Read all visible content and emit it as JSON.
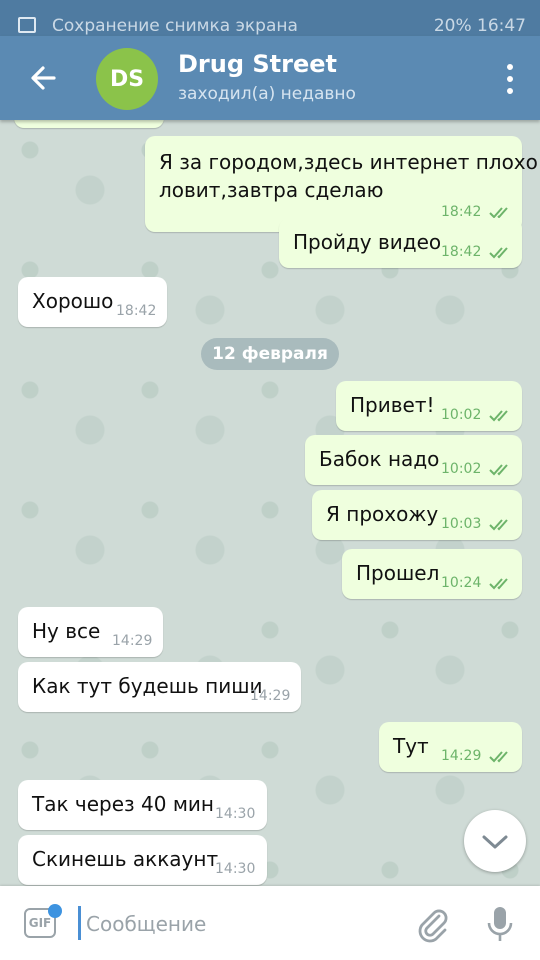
{
  "status_bar": {
    "notification_text": "Сохранение снимка экрана",
    "right_text": "20%  16:47"
  },
  "header": {
    "avatar_initials": "DS",
    "avatar_color": "#8bc34a",
    "title": "Drug Street",
    "status": "заходил(а) недавно"
  },
  "messages": [
    {
      "dir": "out",
      "text": "Я за городом,здесь интернет плохо",
      "text2": "ловит,завтра сделаю",
      "time": "18:42",
      "read": true
    },
    {
      "dir": "out",
      "text": "Пройду видео",
      "time": "18:42",
      "read": true
    },
    {
      "dir": "in",
      "text": "Хорошо",
      "time": "18:42"
    },
    {
      "dir": "out",
      "text": "Привет!",
      "time": "10:02",
      "read": true
    },
    {
      "dir": "out",
      "text": "Бабок надо",
      "time": "10:02",
      "read": true
    },
    {
      "dir": "out",
      "text": "Я прохожу",
      "time": "10:03",
      "read": true
    },
    {
      "dir": "out",
      "text": "Прошел",
      "time": "10:24",
      "read": true
    },
    {
      "dir": "in",
      "text": "Ну все",
      "time": "14:29"
    },
    {
      "dir": "in",
      "text": "Как тут будешь пиши",
      "time": "14:29"
    },
    {
      "dir": "out",
      "text": "Тут",
      "time": "14:29",
      "read": true
    },
    {
      "dir": "in",
      "text": "Так через 40 мин",
      "time": "14:30"
    },
    {
      "dir": "in",
      "text": "Скинешь аккаунт",
      "time": "14:30"
    }
  ],
  "date_separator": "12 февраля",
  "composer": {
    "gif_label": "GIF",
    "placeholder": "Сообщение"
  },
  "icons": {
    "back": "arrow-left-icon",
    "menu": "more-vertical-icon",
    "scroll_down": "chevron-down-icon",
    "attach": "paperclip-icon",
    "mic": "microphone-icon"
  },
  "colors": {
    "header": "#5b8ab3",
    "outgoing_bubble": "#efffde",
    "incoming_bubble": "#ffffff",
    "read_check": "#6db46a"
  }
}
